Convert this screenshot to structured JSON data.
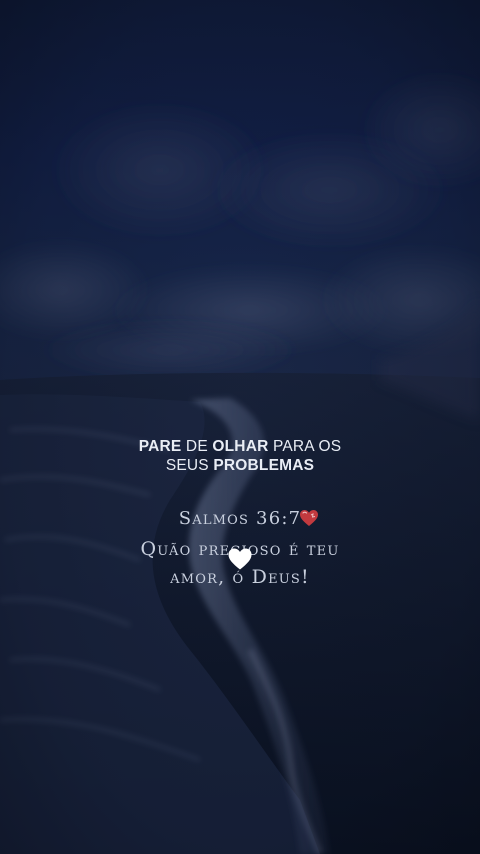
{
  "headline": {
    "line1": [
      {
        "text": "PARE",
        "weight": "bold"
      },
      {
        "text": " DE ",
        "weight": "regular"
      },
      {
        "text": "OLHAR",
        "weight": "bold"
      },
      {
        "text": " PARA OS",
        "weight": "regular"
      }
    ],
    "line2": [
      {
        "text": "SEUS ",
        "weight": "regular"
      },
      {
        "text": "PROBLEMAS",
        "weight": "bold"
      }
    ]
  },
  "verse": {
    "reference": "Salmos 36:7",
    "line1": "Quão precioso é teu",
    "line2": "amor, ó Deus!"
  },
  "icons": {
    "ref_heart": "red-heart-icon",
    "overlay_heart": "white-heart-icon"
  },
  "colors": {
    "text": "#e9edf5",
    "verse_text": "#c9d0de",
    "red_heart": "#c23a3f",
    "white_heart": "#ffffff",
    "sky": "#13214a",
    "sea": "#0a1222"
  }
}
